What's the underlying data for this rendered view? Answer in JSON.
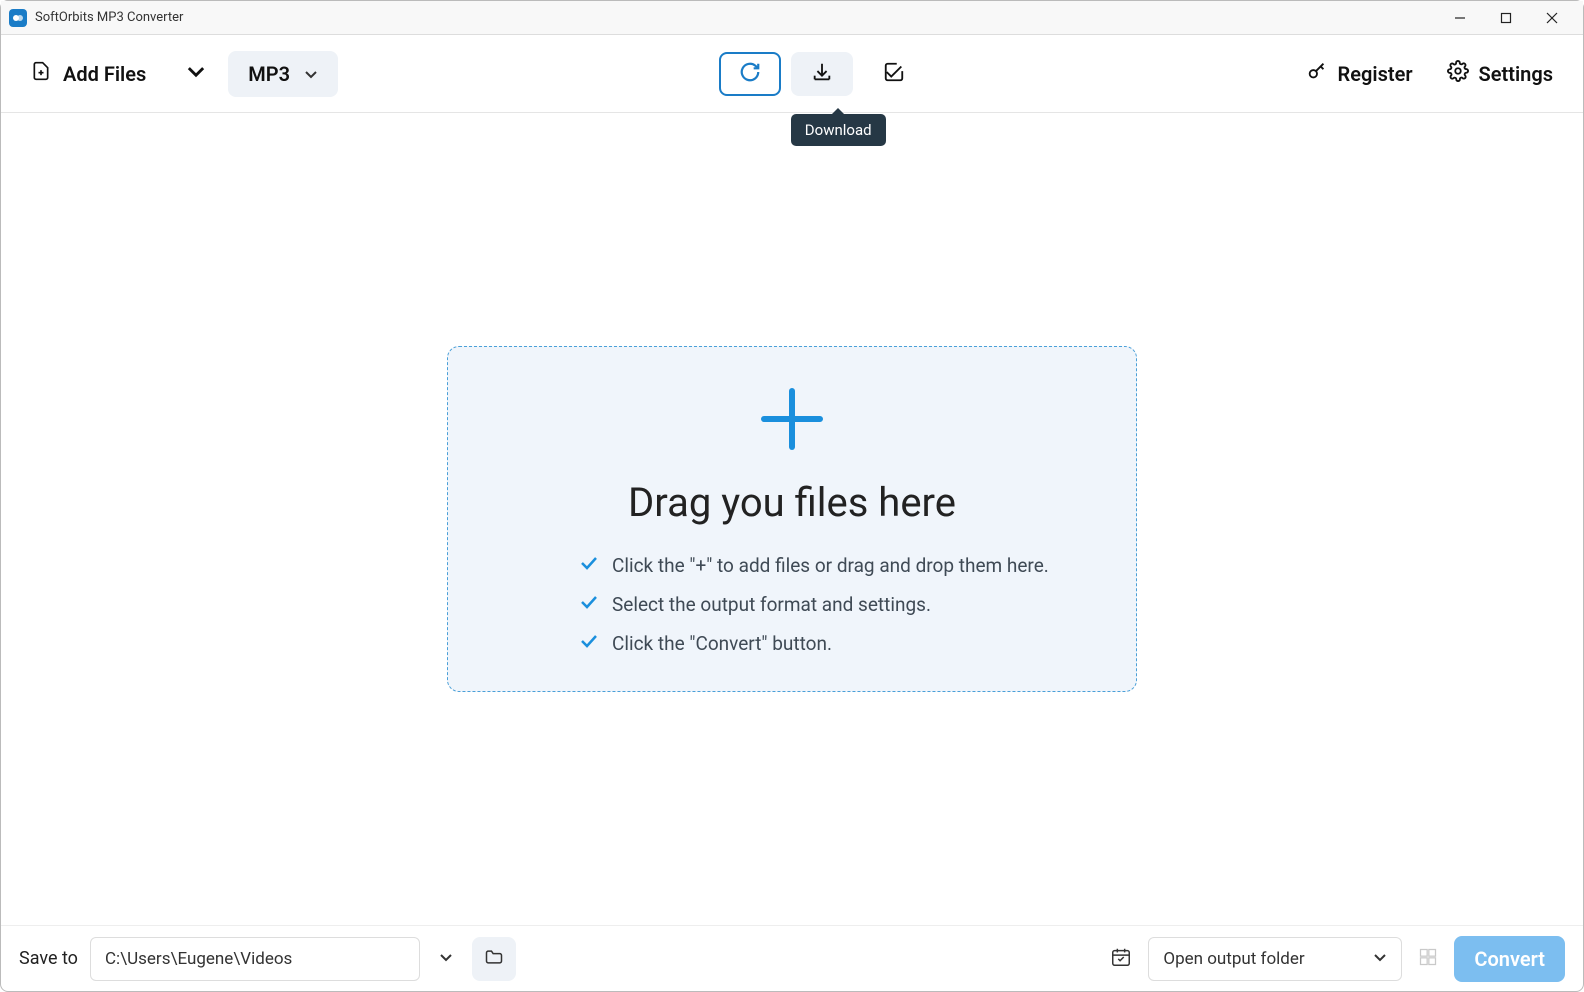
{
  "titlebar": {
    "title": "SoftOrbits MP3 Converter"
  },
  "toolbar": {
    "add_files_label": "Add Files",
    "format_label": "MP3",
    "tooltip_download": "Download",
    "register_label": "Register",
    "settings_label": "Settings"
  },
  "dropzone": {
    "title": "Drag you files here",
    "items": [
      "Click the \"+\" to add files or drag and drop them here.",
      "Select the output format and settings.",
      "Click the \"Convert\" button."
    ]
  },
  "footer": {
    "save_to_label": "Save to",
    "path_value": "C:\\Users\\Eugene\\Videos",
    "open_output_label": "Open output folder",
    "convert_label": "Convert"
  }
}
